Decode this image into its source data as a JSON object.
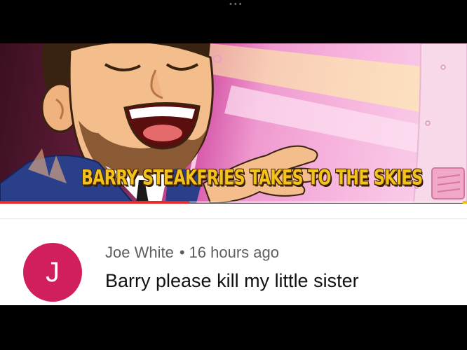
{
  "video": {
    "caption": "BARRY STEAKFRIES TAKES TO THE SKIES",
    "progress_fraction": 0.405,
    "colors": {
      "progress_played": "#e52b2b",
      "progress_end": "#f0c020",
      "caption": "#f4c21c"
    }
  },
  "comment": {
    "avatar_letter": "J",
    "author": "Joe White",
    "separator": "•",
    "time": "16 hours ago",
    "text": "Barry please kill my little sister",
    "colors": {
      "avatar": "#d11f5e"
    }
  },
  "topbar": {
    "menu_icon": "more-dots-icon"
  }
}
